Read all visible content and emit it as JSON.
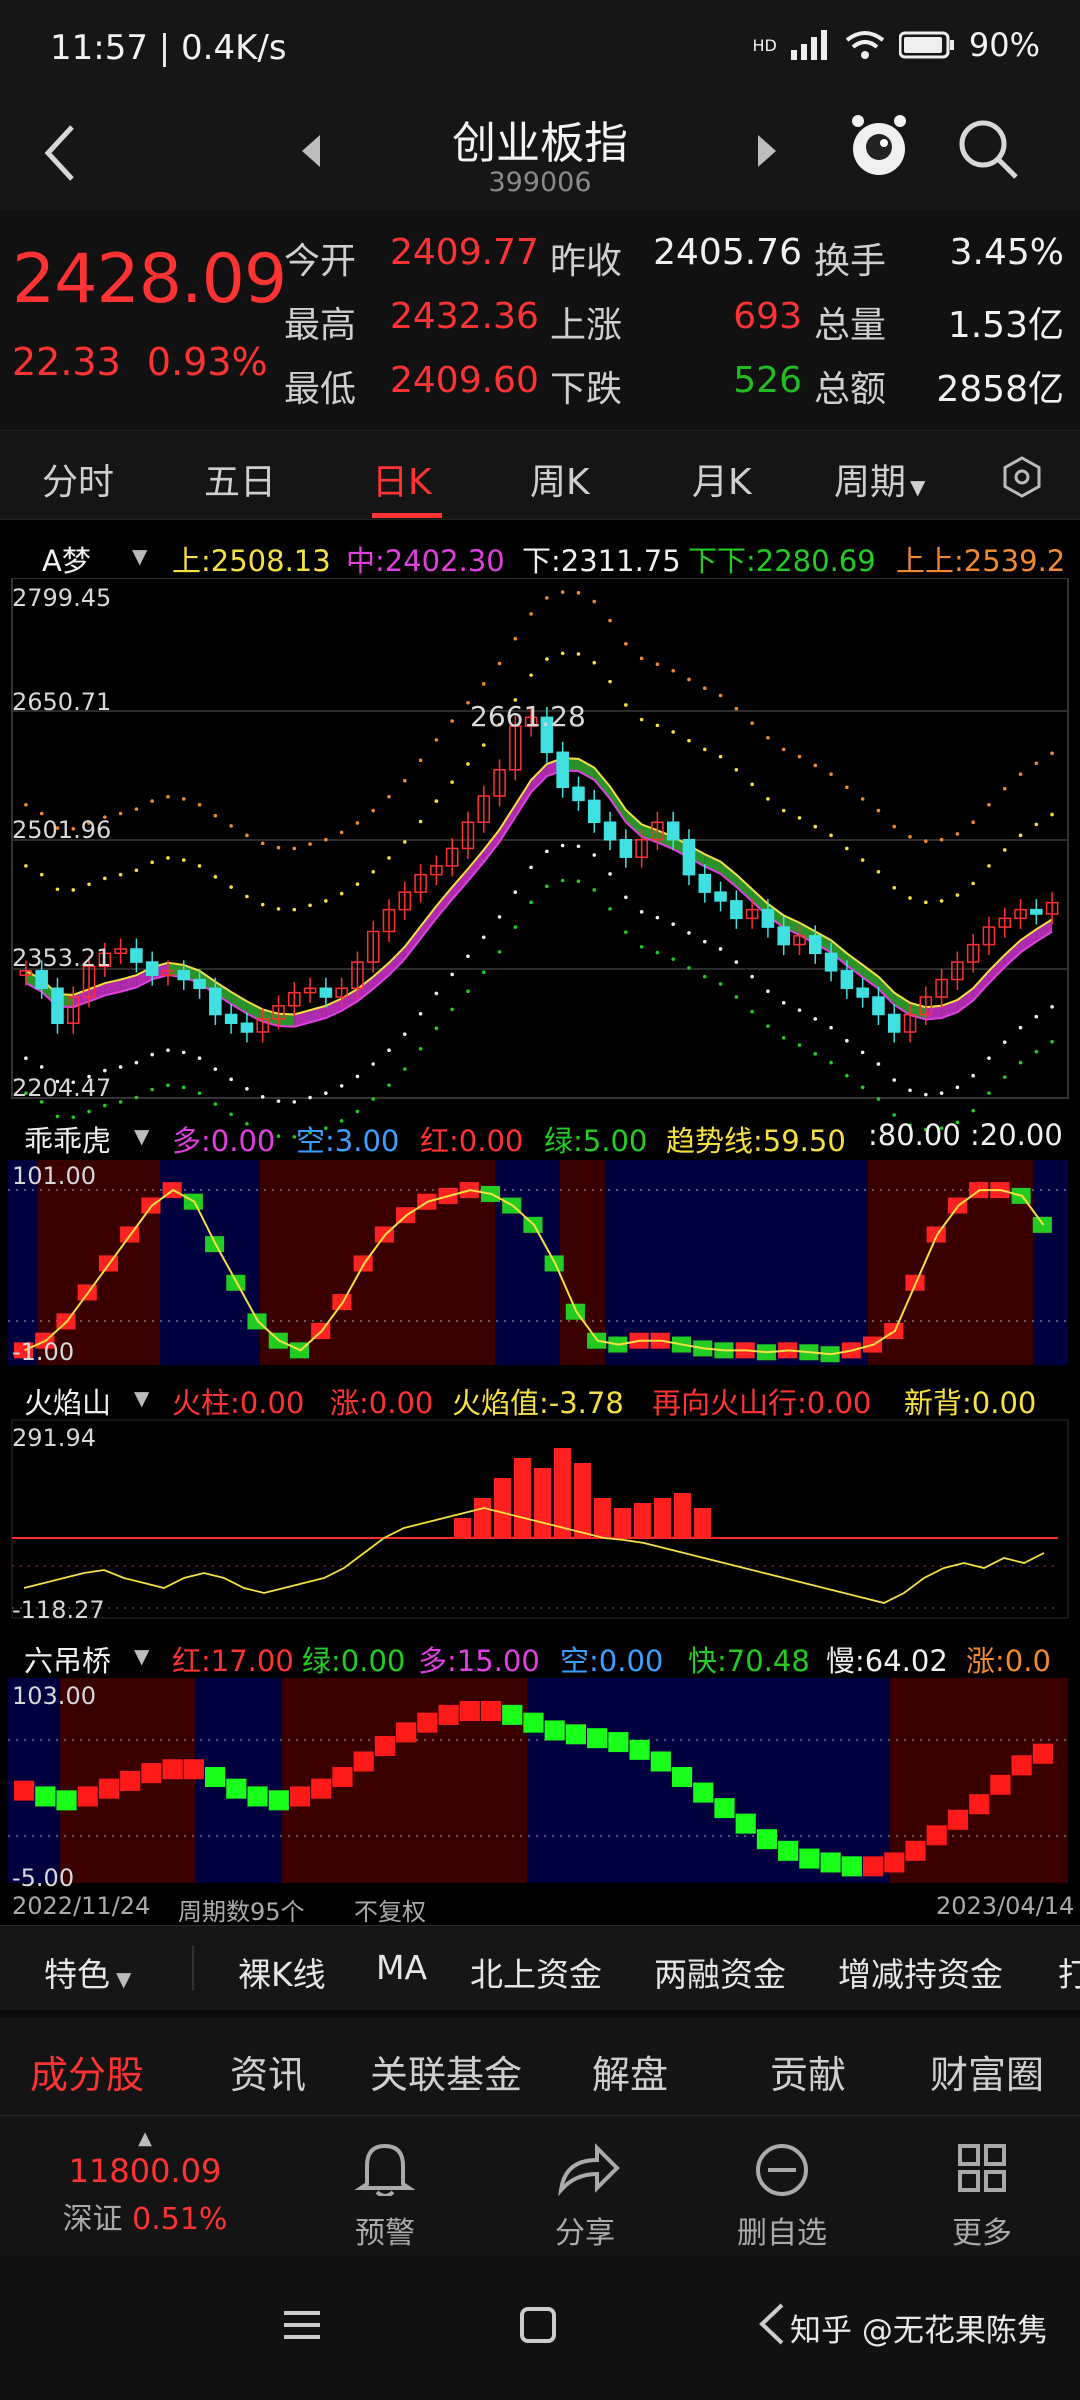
{
  "status_bar": {
    "time": "11:57 | 0.4K/s",
    "network": "HD",
    "battery": "90%"
  },
  "header": {
    "title": "创业板指",
    "code": "399006"
  },
  "quote": {
    "price": "2428.09",
    "change": "22.33",
    "change_pct": "0.93%",
    "rows": [
      {
        "k1": "今开",
        "v1": "2409.77",
        "k2": "昨收",
        "v2": "2405.76",
        "k3": "换手",
        "v3": "3.45%"
      },
      {
        "k1": "最高",
        "v1": "2432.36",
        "k2": "上涨",
        "v2": "693",
        "k3": "总量",
        "v3": "1.53亿"
      },
      {
        "k1": "最低",
        "v1": "2409.60",
        "k2": "下跌",
        "v2": "526",
        "k3": "总额",
        "v3": "2858亿"
      }
    ]
  },
  "tabs": [
    "分时",
    "五日",
    "日K",
    "周K",
    "月K",
    "周期"
  ],
  "active_tab": "日K",
  "main_indicator": {
    "name": "A梦",
    "items": [
      {
        "label": "上:2508.13",
        "color": "#f5e042"
      },
      {
        "label": "中:2402.30",
        "color": "#e040e0"
      },
      {
        "label": "下:2311.75",
        "color": "#f0f0f0"
      },
      {
        "label": "下下:2280.69",
        "color": "#22cc22"
      },
      {
        "label": "上上:2539.2",
        "color": "#f08a30"
      }
    ],
    "y_labels": [
      "2799.45",
      "2650.71",
      "2501.96",
      "2353.21",
      "2204.47"
    ],
    "peak_label": "2661.28"
  },
  "ind2": {
    "name": "乖乖虎",
    "items": [
      {
        "label": "多:0.00",
        "color": "#e040e0"
      },
      {
        "label": "空:3.00",
        "color": "#3aa0ff"
      },
      {
        "label": "红:0.00",
        "color": "#ff3333"
      },
      {
        "label": "绿:5.00",
        "color": "#22cc22"
      },
      {
        "label": "趋势线:59.50",
        "color": "#f5e042"
      },
      {
        "label": ":80.00",
        "color": "#f0f0f0"
      },
      {
        "label": ":20.00",
        "color": "#f0f0f0"
      }
    ],
    "y_top": "101.00",
    "y_bottom": "-1.00"
  },
  "ind3": {
    "name": "火焰山",
    "items": [
      {
        "label": "火柱:0.00",
        "color": "#ff3333"
      },
      {
        "label": "涨:0.00",
        "color": "#ff3333"
      },
      {
        "label": "火焰值:-3.78",
        "color": "#f5e042"
      },
      {
        "label": "再向火山行:0.00",
        "color": "#ff3333"
      },
      {
        "label": "新背:0.00",
        "color": "#f5e042"
      }
    ],
    "y_top": "291.94",
    "y_bottom": "-118.27"
  },
  "ind4": {
    "name": "六吊桥",
    "items": [
      {
        "label": "红:17.00",
        "color": "#ff3333"
      },
      {
        "label": "绿:0.00",
        "color": "#22cc22"
      },
      {
        "label": "多:15.00",
        "color": "#e040e0"
      },
      {
        "label": "空:0.00",
        "color": "#3aa0ff"
      },
      {
        "label": "快:70.48",
        "color": "#22cc22"
      },
      {
        "label": "慢:64.02",
        "color": "#f0f0f0"
      },
      {
        "label": "涨:0.0",
        "color": "#f08a30"
      }
    ],
    "y_top": "103.00",
    "y_bottom": "-5.00"
  },
  "chart_footer": {
    "start_date": "2022/11/24",
    "period_count": "周期数95个",
    "adjust": "不复权",
    "end_date": "2023/04/14"
  },
  "feature_bar": [
    "特色",
    "裸K线",
    "MA",
    "北上资金",
    "两融资金",
    "增减持资金",
    "打"
  ],
  "bottom_tabs": [
    "成分股",
    "资讯",
    "关联基金",
    "解盘",
    "贡献",
    "财富圈"
  ],
  "active_bottom_tab": "成分股",
  "related_index": {
    "value": "11800.09",
    "name": "深证",
    "pct": "0.51%"
  },
  "actions": [
    "预警",
    "分享",
    "删自选",
    "更多"
  ],
  "watermark": "知乎 @无花果陈隽",
  "chart_data": {
    "type": "candlestick",
    "x_range": [
      "2022/11/24",
      "2023/04/14"
    ],
    "period_count": 95,
    "ylim": [
      2204.47,
      2799.45
    ],
    "y_ticks": [
      2204.47,
      2353.21,
      2501.96,
      2650.71,
      2799.45
    ],
    "peak": 2661.28,
    "close_trend": [
      2350,
      2330,
      2290,
      2320,
      2355,
      2370,
      2375,
      2360,
      2345,
      2350,
      2340,
      2330,
      2300,
      2290,
      2280,
      2295,
      2310,
      2325,
      2330,
      2320,
      2330,
      2360,
      2395,
      2420,
      2440,
      2460,
      2470,
      2490,
      2520,
      2550,
      2580,
      2630,
      2640,
      2600,
      2560,
      2545,
      2520,
      2500,
      2480,
      2500,
      2520,
      2500,
      2460,
      2440,
      2430,
      2410,
      2420,
      2400,
      2380,
      2390,
      2370,
      2350,
      2330,
      2320,
      2300,
      2280,
      2300,
      2320,
      2340,
      2360,
      2380,
      2400,
      2410,
      2420,
      2415,
      2428
    ],
    "series": [
      {
        "name": "上",
        "last": 2508.13
      },
      {
        "name": "中",
        "last": 2402.3
      },
      {
        "name": "下",
        "last": 2311.75
      },
      {
        "name": "下下",
        "last": 2280.69
      },
      {
        "name": "上上",
        "last": 2539.2
      }
    ]
  }
}
